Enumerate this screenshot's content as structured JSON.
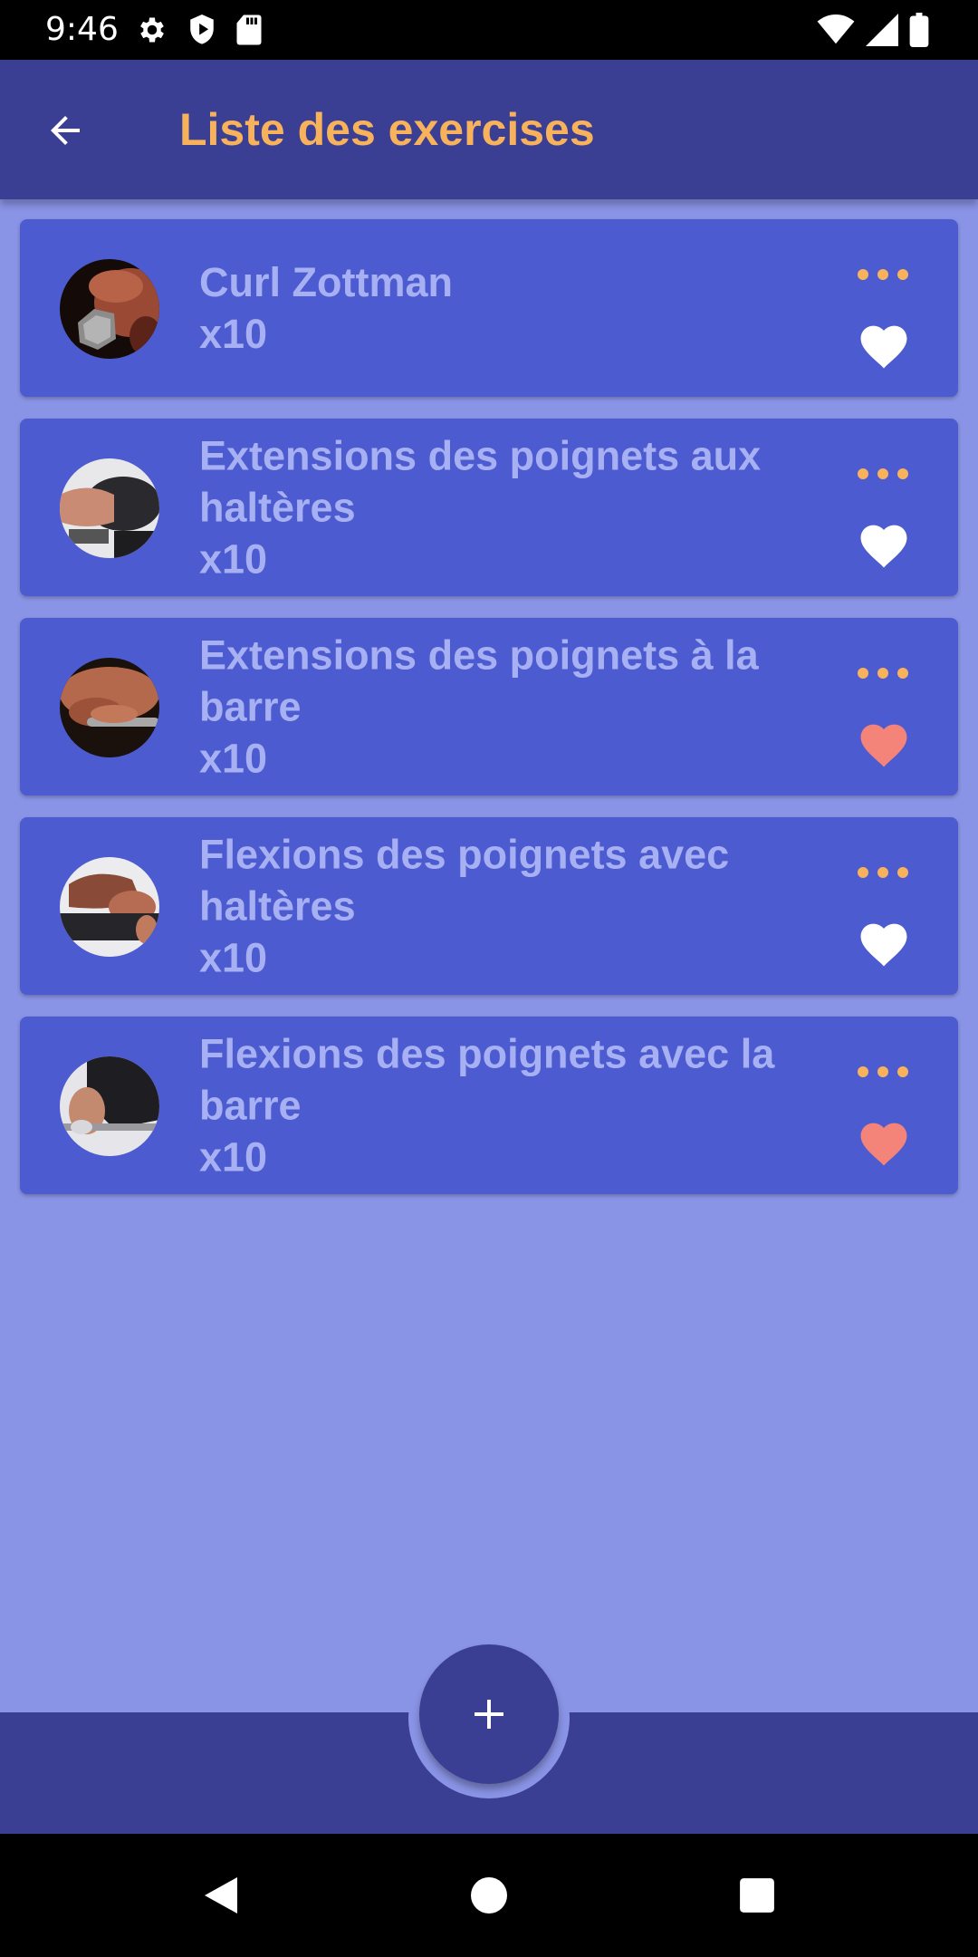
{
  "status_bar": {
    "time": "9:46",
    "left_icons": [
      "settings-icon",
      "play-protect-icon",
      "sd-card-icon"
    ],
    "right_icons": [
      "wifi-icon",
      "signal-icon",
      "battery-icon"
    ]
  },
  "app_bar": {
    "title": "Liste des exercises",
    "back_icon": "arrow-left-icon"
  },
  "colors": {
    "app_bar": "#3B3F94",
    "background": "#8A94E6",
    "card": "#4D5BD0",
    "card_text": "#A7B0F2",
    "title_accent": "#F8B25C",
    "favorite_on": "#F4837A",
    "favorite_off": "#FFFFFF"
  },
  "exercises": [
    {
      "name": "Curl Zottman",
      "reps": "x10",
      "favorite": false
    },
    {
      "name": "Extensions des poignets aux haltères",
      "reps": "x10",
      "favorite": false
    },
    {
      "name": "Extensions des poignets à la barre",
      "reps": "x10",
      "favorite": true
    },
    {
      "name": "Flexions des poignets avec haltères",
      "reps": "x10",
      "favorite": false
    },
    {
      "name": "Flexions des poignets avec la barre",
      "reps": "x10",
      "favorite": true
    }
  ],
  "fab": {
    "icon": "plus-icon"
  },
  "nav_bar": {
    "icons": [
      "back-triangle-icon",
      "home-circle-icon",
      "recents-square-icon"
    ]
  }
}
